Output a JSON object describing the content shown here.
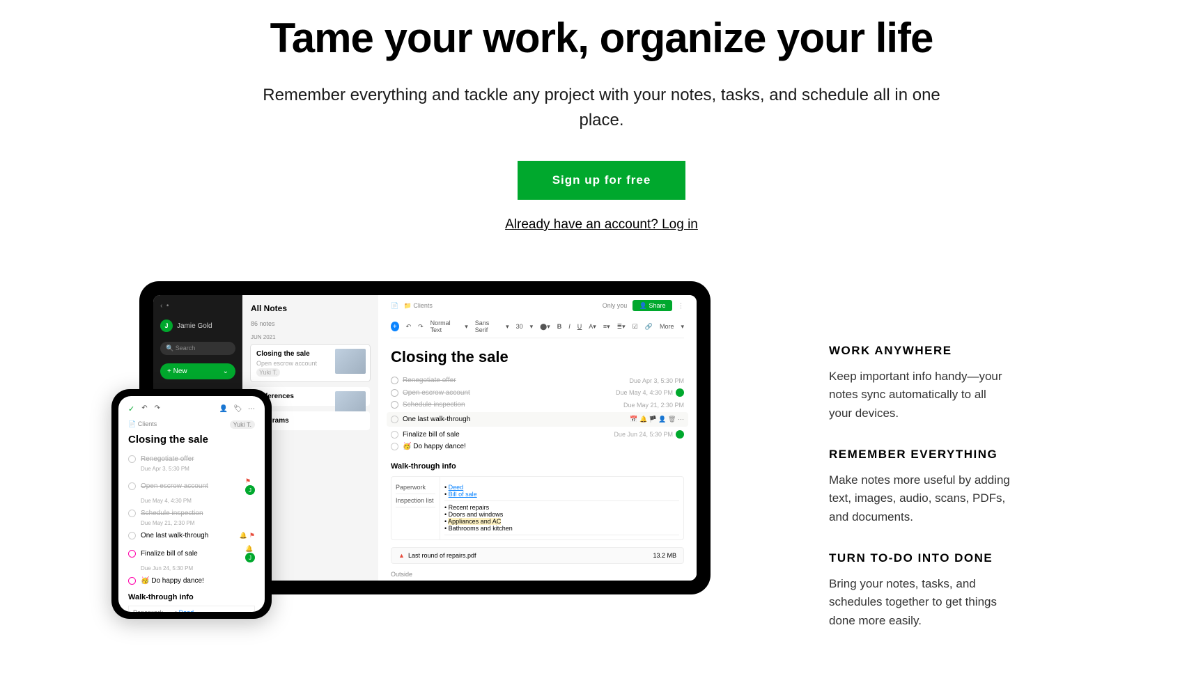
{
  "hero": {
    "title": "Tame your work, organize your life",
    "subtitle": "Remember everything and tackle any project with your notes, tasks, and schedule all in one place.",
    "cta": "Sign up for free",
    "login": "Already have an account? Log in"
  },
  "features": [
    {
      "title": "WORK ANYWHERE",
      "body": "Keep important info handy—your notes sync automatically to all your devices."
    },
    {
      "title": "REMEMBER EVERYTHING",
      "body": "Make notes more useful by adding text, images, audio, scans, PDFs, and documents."
    },
    {
      "title": "TURN TO-DO INTO DONE",
      "body": "Bring your notes, tasks, and schedules together to get things done more easily."
    }
  ],
  "tablet": {
    "user": "Jamie Gold",
    "userInitial": "J",
    "search": "Search",
    "newLabel": "+  New",
    "listTitle": "All Notes",
    "listSub": "86 notes",
    "month": "JUN 2021",
    "crumb": "Clients",
    "onlyYou": "Only you",
    "share": "Share",
    "toolbar": {
      "style": "Normal Text",
      "font": "Sans Serif",
      "size": "30",
      "more": "More"
    },
    "noteTitle": "Closing the sale",
    "tasks": [
      {
        "txt": "Renegotiate offer",
        "due": "Due Apr 3, 5:30 PM",
        "done": true
      },
      {
        "txt": "Open escrow account",
        "due": "Due May 4, 4:30 PM",
        "done": true,
        "av": true
      },
      {
        "txt": "Schedule inspection",
        "due": "Due May 21, 2:30 PM",
        "done": true
      },
      {
        "txt": "One last walk-through",
        "due": "",
        "done": false,
        "hl": true
      },
      {
        "txt": "Finalize bill of sale",
        "due": "Due Jun 24, 5:30 PM",
        "done": false,
        "av": true
      },
      {
        "txt": "🥳 Do happy dance!",
        "due": "",
        "done": false
      }
    ],
    "section": "Walk-through info",
    "tableRows": [
      {
        "label": "Paperwork",
        "items": [
          "Deed",
          "Bill of sale"
        ],
        "links": true
      },
      {
        "label": "Inspection list",
        "items": [
          "Recent repairs",
          "Doors and windows",
          "Appliances and AC",
          "Bathrooms and kitchen"
        ],
        "hl": 2
      }
    ],
    "file": {
      "name": "Last round of repairs.pdf",
      "size": "13.2 MB"
    },
    "outside": "Outside",
    "listNotes": [
      {
        "title": "Closing the sale"
      },
      {
        "title": "References"
      },
      {
        "title": "Programs"
      }
    ]
  },
  "phone": {
    "crumb": "Clients",
    "tag": "Yuki T.",
    "title": "Closing the sale",
    "tasks": [
      {
        "txt": "Renegotiate offer",
        "due": "Due Apr 3, 5:30 PM",
        "done": true
      },
      {
        "txt": "Open escrow account",
        "due": "Due May 4, 4:30 PM",
        "done": true,
        "flag": true,
        "av": true
      },
      {
        "txt": "Schedule inspection",
        "due": "Due May 21, 2:30 PM",
        "done": true
      },
      {
        "txt": "One last walk-through",
        "due": "",
        "done": false,
        "bell": true,
        "flag": true
      },
      {
        "txt": "Finalize bill of sale",
        "due": "Due Jun 24, 5:30 PM",
        "done": false,
        "bell": true,
        "av": true,
        "pink": true
      },
      {
        "txt": "🥳 Do happy dance!",
        "due": "",
        "done": false,
        "pink": true
      }
    ],
    "section": "Walk-through info",
    "row": {
      "label": "Paperwork",
      "link": "Deed"
    }
  }
}
